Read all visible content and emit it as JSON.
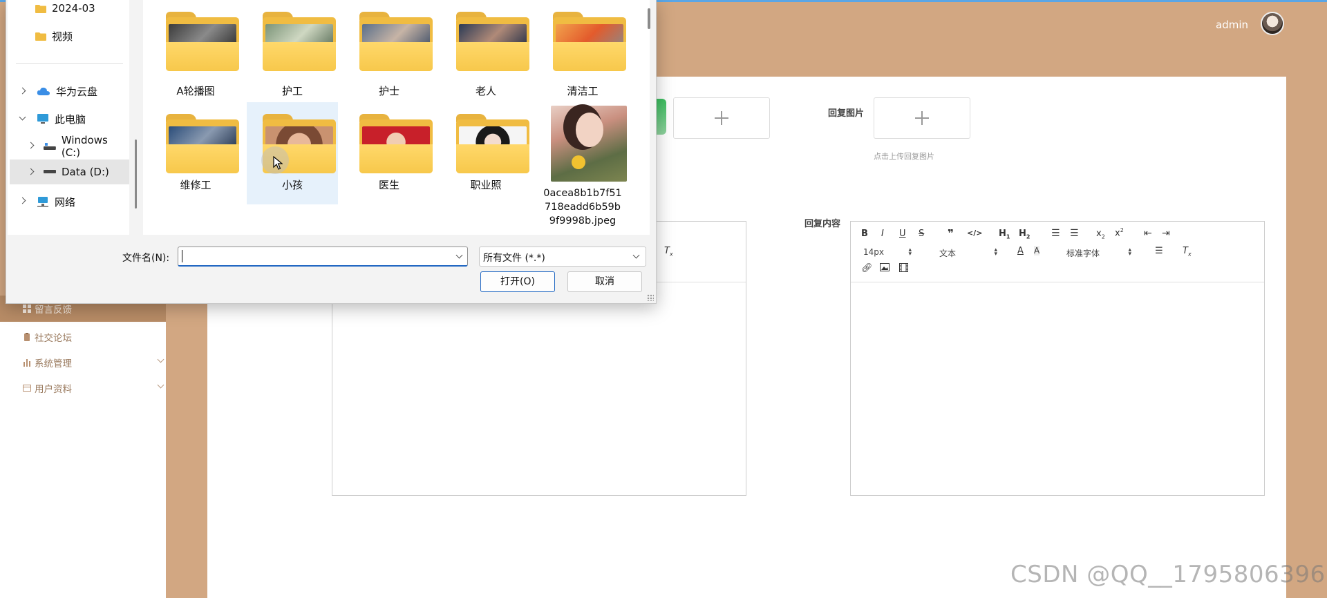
{
  "topbar": {
    "user_name": "admin"
  },
  "sidebar": {
    "items": [
      {
        "label": "留言反馈",
        "icon": "grid-icon",
        "active": true
      },
      {
        "label": "社交论坛",
        "icon": "clipboard-icon",
        "active": false
      },
      {
        "label": "系统管理",
        "icon": "bar-chart-icon",
        "active": false,
        "expandable": true
      },
      {
        "label": "用户资料",
        "icon": "card-icon",
        "active": false,
        "expandable": true
      }
    ]
  },
  "form": {
    "reply_image_label": "回复图片",
    "reply_image_tip": "点击上传回复图片",
    "reply_content_label": "回复内容",
    "editor": {
      "font_size": "14px",
      "paragraph": "文本",
      "font_family": "标准字体"
    }
  },
  "dialog": {
    "nav": {
      "items": [
        {
          "label": "2024-03",
          "icon": "folder-icon"
        },
        {
          "label": "视频",
          "icon": "folder-icon"
        },
        {
          "label": "华为云盘",
          "icon": "cloud-icon"
        },
        {
          "label": "此电脑",
          "icon": "monitor-icon"
        },
        {
          "label": "Windows (C:)",
          "icon": "drive-icon"
        },
        {
          "label": "Data (D:)",
          "icon": "drive-icon",
          "selected": true
        },
        {
          "label": "网络",
          "icon": "network-icon"
        }
      ]
    },
    "files": [
      {
        "name": "A轮播图",
        "type": "folder"
      },
      {
        "name": "护工",
        "type": "folder"
      },
      {
        "name": "护士",
        "type": "folder"
      },
      {
        "name": "老人",
        "type": "folder"
      },
      {
        "name": "清洁工",
        "type": "folder"
      },
      {
        "name": "维修工",
        "type": "folder"
      },
      {
        "name": "小孩",
        "type": "folder",
        "hover": true
      },
      {
        "name": "医生",
        "type": "folder"
      },
      {
        "name": "职业照",
        "type": "folder"
      },
      {
        "name_lines": [
          "0acea8b1b7f51",
          "718eadd6b59b",
          "9f9998b.jpeg"
        ],
        "type": "image"
      }
    ],
    "filename_label": "文件名(N):",
    "filename_value": "",
    "filter_value": "所有文件 (*.*)",
    "open_button": "打开(O)",
    "cancel_button": "取消"
  },
  "watermark": "CSDN @QQ__1795806396",
  "colors": {
    "app_background": "#d2a782",
    "sidebar_active": "#b88c66",
    "dialog_accent": "#1f66c2",
    "folder_yellow": "#f0bc42"
  }
}
